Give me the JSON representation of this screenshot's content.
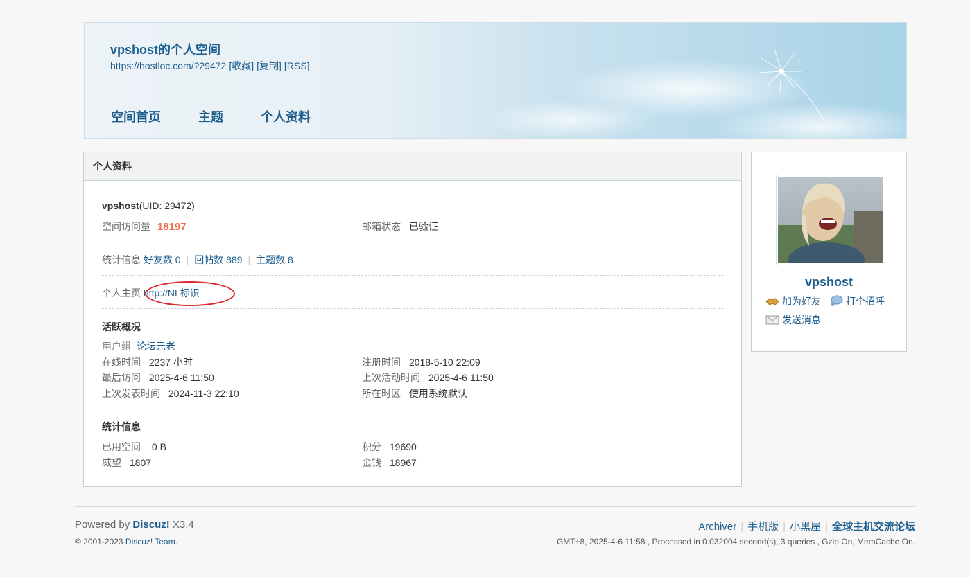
{
  "header": {
    "title": "vpshost的个人空间",
    "url": "https://hostloc.com/?29472",
    "links": [
      "[收藏]",
      "[复制]",
      "[RSS]"
    ],
    "nav": [
      "空间首页",
      "主题",
      "个人资料"
    ]
  },
  "profile": {
    "panel_title": "个人资料",
    "username": "vpshost",
    "uid_text": "(UID: 29472)",
    "visits_label": "空间访问量",
    "visits_value": "18197",
    "email_label": "邮箱状态",
    "email_value": "已验证",
    "stats_label": "统计信息",
    "friends": "好友数 0",
    "replies": "回帖数 889",
    "threads": "主题数 8",
    "homepage_label": "个人主页",
    "homepage_value": "http://NL标识",
    "activity_title": "活跃概况",
    "usergroup_label": "用户组",
    "usergroup_value": "论坛元老",
    "online_label": "在线时间",
    "online_value": "2237 小时",
    "register_label": "注册时间",
    "register_value": "2018-5-10 22:09",
    "lastvisit_label": "最后访问",
    "lastvisit_value": "2025-4-6 11:50",
    "lastactive_label": "上次活动时间",
    "lastactive_value": "2025-4-6 11:50",
    "lastpost_label": "上次发表时间",
    "lastpost_value": "2024-11-3 22:10",
    "timezone_label": "所在时区",
    "timezone_value": "使用系统默认",
    "stats_title": "统计信息",
    "space_label": "已用空间",
    "space_value": "0 B",
    "credits_label": "积分",
    "credits_value": "19690",
    "prestige_label": "威望",
    "prestige_value": "1807",
    "money_label": "金钱",
    "money_value": "18967"
  },
  "sidebar": {
    "name": "vpshost",
    "add_friend": "加为好友",
    "poke": "打个招呼",
    "message": "发送消息"
  },
  "footer": {
    "powered_prefix": "Powered by ",
    "powered_brand": "Discuz!",
    "powered_version": " X3.4",
    "copyright_prefix": "© 2001-2023 ",
    "copyright_link": "Discuz! Team",
    "copyright_suffix": ".",
    "links": [
      "Archiver",
      "手机版",
      "小黑屋"
    ],
    "forum_name": "全球主机交流论坛",
    "stats": "GMT+8, 2025-4-6 11:58 , Processed in 0.032004 second(s), 3 queries , Gzip On, MemCache On."
  }
}
